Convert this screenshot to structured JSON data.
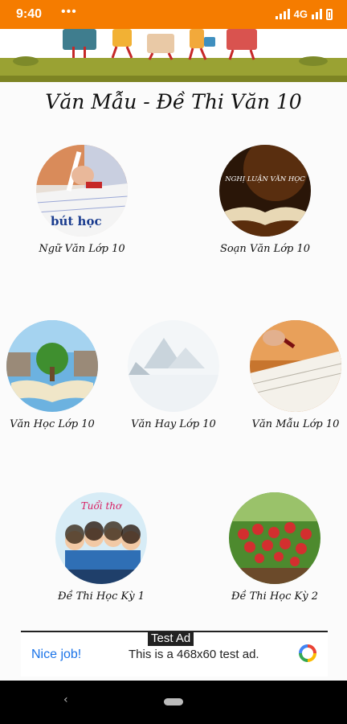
{
  "status_bar": {
    "time": "9:40",
    "more": "•••",
    "network": "4G"
  },
  "header": {
    "title": "Văn Mẫu - Đề Thi Văn 10"
  },
  "items": [
    {
      "label": "Ngữ Văn Lớp 10",
      "image_text": "bút học"
    },
    {
      "label": "Soạn Văn Lớp 10",
      "image_text": "NGHỊ LUẬN VĂN HỌC"
    },
    {
      "label": "Văn Học Lớp 10"
    },
    {
      "label": "Văn Hay Lớp 10"
    },
    {
      "label": "Văn Mẫu Lớp 10"
    },
    {
      "label": "Đề Thi Học Kỳ 1",
      "image_text": "Tuổi thơ"
    },
    {
      "label": "Đề Thi Học Kỳ 2"
    }
  ],
  "ad": {
    "tag": "Test Ad",
    "headline": "Nice job!",
    "description": "This is a 468x60 test ad."
  },
  "colors": {
    "status_bar": "#f57c00",
    "ad_link": "#1a73e8"
  }
}
